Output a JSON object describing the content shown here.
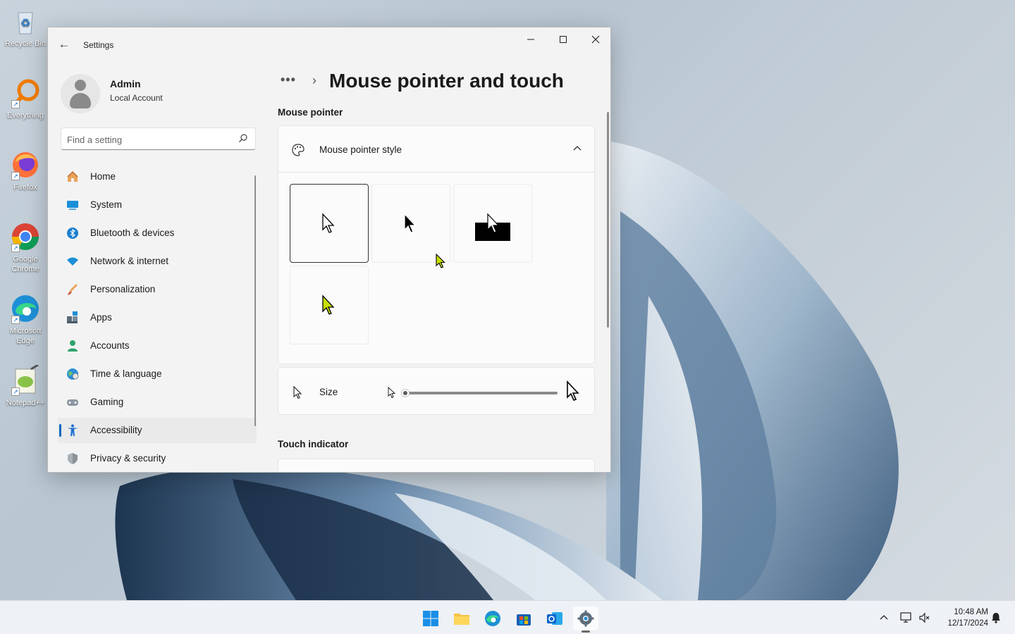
{
  "desktop": {
    "icons": [
      {
        "label": "Recycle Bin",
        "icon": "recycle-bin-icon"
      },
      {
        "label": "Everything",
        "icon": "everything-icon"
      },
      {
        "label": "Firefox",
        "icon": "firefox-icon"
      },
      {
        "label": "Google Chrome",
        "icon": "chrome-icon"
      },
      {
        "label": "Microsoft Edge",
        "icon": "edge-icon"
      },
      {
        "label": "Notepad++",
        "icon": "notepadpp-icon"
      }
    ]
  },
  "window": {
    "app_title": "Settings",
    "controls": {
      "minimize": "—",
      "maximize": "☐",
      "close": "✕"
    },
    "back_glyph": "←"
  },
  "profile": {
    "name": "Admin",
    "account_type": "Local Account"
  },
  "search": {
    "placeholder": "Find a setting",
    "value": ""
  },
  "sidebar": {
    "items": [
      {
        "label": "Home",
        "icon": "home-icon",
        "active": false
      },
      {
        "label": "System",
        "icon": "system-icon",
        "active": false
      },
      {
        "label": "Bluetooth & devices",
        "icon": "bluetooth-icon",
        "active": false
      },
      {
        "label": "Network & internet",
        "icon": "wifi-icon",
        "active": false
      },
      {
        "label": "Personalization",
        "icon": "brush-icon",
        "active": false
      },
      {
        "label": "Apps",
        "icon": "apps-icon",
        "active": false
      },
      {
        "label": "Accounts",
        "icon": "accounts-icon",
        "active": false
      },
      {
        "label": "Time & language",
        "icon": "globe-icon",
        "active": false
      },
      {
        "label": "Gaming",
        "icon": "gamepad-icon",
        "active": false
      },
      {
        "label": "Accessibility",
        "icon": "accessibility-icon",
        "active": true
      },
      {
        "label": "Privacy & security",
        "icon": "shield-icon",
        "active": false
      }
    ]
  },
  "main": {
    "breadcrumb_more": "•••",
    "breadcrumb_sep": "›",
    "page_title": "Mouse pointer and touch",
    "section_mouse_pointer": "Mouse pointer",
    "pointer_style": {
      "label": "Mouse pointer style",
      "expanded": true,
      "options": [
        {
          "name": "white",
          "selected": true
        },
        {
          "name": "black",
          "selected": false
        },
        {
          "name": "inverted",
          "selected": false
        },
        {
          "name": "custom",
          "selected": false,
          "color": "#c8e000"
        }
      ]
    },
    "size": {
      "label": "Size",
      "value": 1,
      "min": 1,
      "max": 15
    },
    "section_touch_indicator": "Touch indicator"
  },
  "taskbar": {
    "apps": [
      {
        "name": "start",
        "icon": "windows-start-icon",
        "active": false
      },
      {
        "name": "file-explorer",
        "icon": "folder-icon",
        "active": false
      },
      {
        "name": "edge",
        "icon": "edge-icon",
        "active": false
      },
      {
        "name": "store",
        "icon": "store-icon",
        "active": false
      },
      {
        "name": "outlook",
        "icon": "outlook-icon",
        "active": false
      },
      {
        "name": "settings",
        "icon": "gear-icon",
        "active": true
      }
    ],
    "time": "10:48 AM",
    "date": "12/17/2024"
  },
  "colors": {
    "accent": "#0067c0",
    "custom_pointer": "#c8e000"
  }
}
